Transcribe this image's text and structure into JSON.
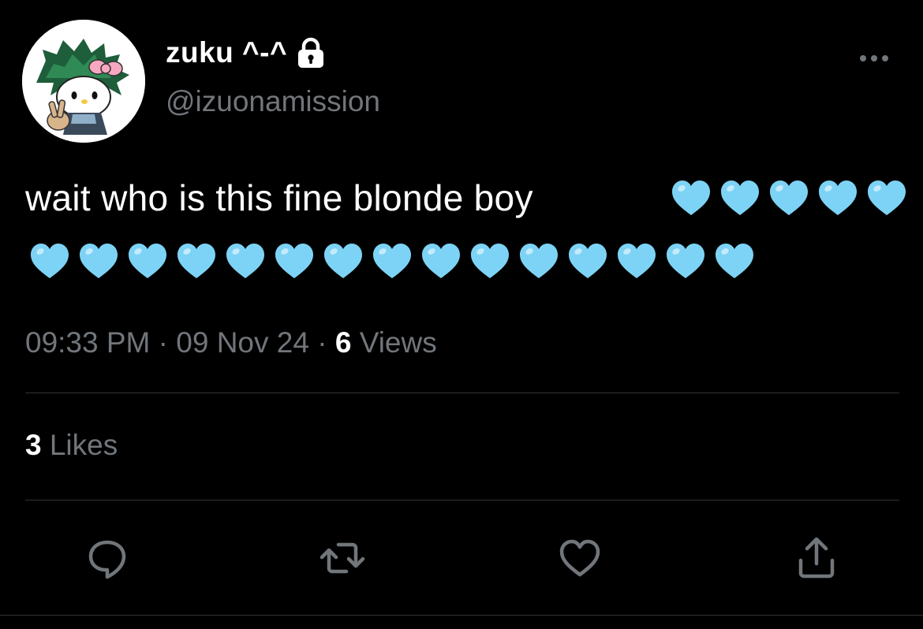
{
  "author": {
    "display_name": "zuku ^-^",
    "handle": "@izuonamission",
    "avatar_icon": "hello-kitty-deku-avatar",
    "protected_icon": "lock-icon"
  },
  "tweet": {
    "text": "wait who is this fine blonde boy",
    "emoji": "🩵",
    "emoji_count_line1": 5,
    "emoji_count_line2": 15
  },
  "meta": {
    "time": "09:33 PM",
    "separator": "·",
    "date": "09 Nov 24",
    "views_count": "6",
    "views_label": "Views"
  },
  "stats": {
    "likes_count": "3",
    "likes_label": "Likes"
  },
  "actions": {
    "reply_icon": "reply-icon",
    "retweet_icon": "retweet-icon",
    "like_icon": "heart-icon",
    "share_icon": "share-icon",
    "more_icon": "more-icon"
  },
  "colors": {
    "background": "#000000",
    "primary_text": "#ffffff",
    "secondary_text": "#71767b",
    "divider": "#2f3336",
    "heart_emoji": "#7dd3f5"
  }
}
